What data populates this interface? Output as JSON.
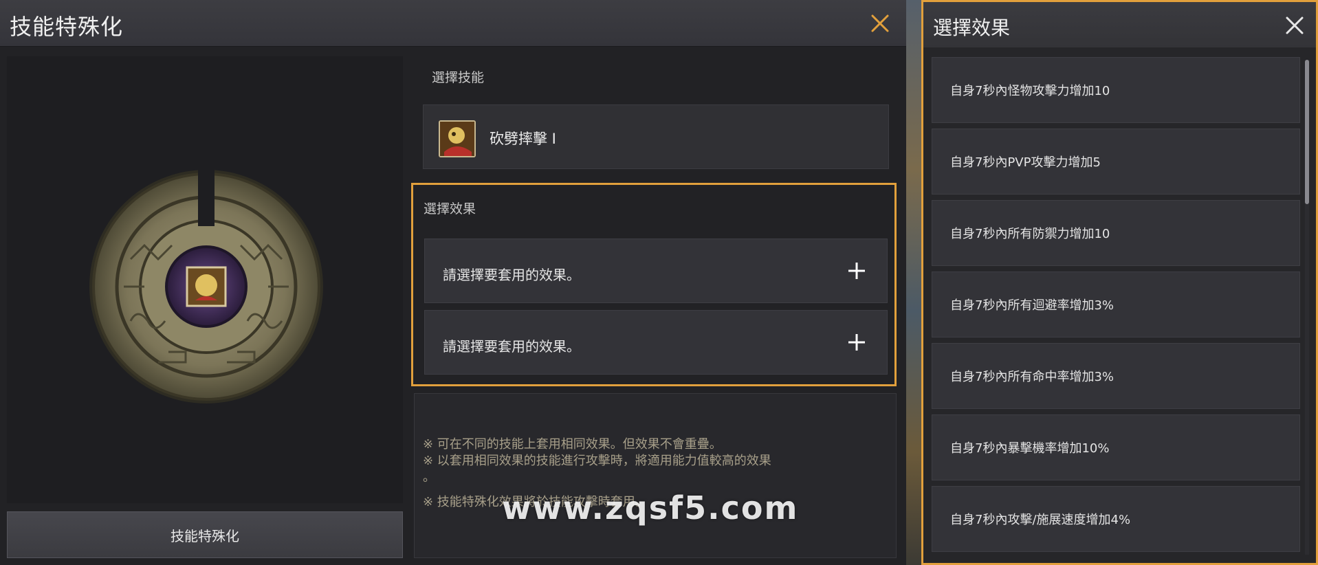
{
  "main": {
    "title": "技能特殊化",
    "specialize_button": "技能特殊化"
  },
  "skill_section": {
    "label": "選擇技能",
    "skill_name": "砍劈摔擊 I"
  },
  "effect_section": {
    "label": "選擇效果",
    "slots": [
      {
        "text": "請選擇要套用的效果。"
      },
      {
        "text": "請選擇要套用的效果。"
      }
    ]
  },
  "notes": [
    "※ 可在不同的技能上套用相同效果。但效果不會重疊。",
    "※ 以套用相同效果的技能進行攻擊時，將適用能力值較高的效果",
    "。",
    "※ 技能特殊化效果將於技能攻擊時套用。"
  ],
  "watermark": "www.zqsf5.com",
  "select_panel": {
    "title": "選擇效果",
    "options": [
      "自身7秒內怪物攻擊力增加10",
      "自身7秒內PVP攻擊力增加5",
      "自身7秒內所有防禦力增加10",
      "自身7秒內所有迴避率增加3%",
      "自身7秒內所有命中率增加3%",
      "自身7秒內暴擊機率增加10%",
      "自身7秒內攻擊/施展速度增加4%"
    ]
  },
  "colors": {
    "accent": "#e2a03c",
    "panel_bg": "#222225",
    "slot_bg": "#333338"
  },
  "icons": {
    "close": "close-icon",
    "plus": "plus-icon",
    "skill": "skill-icon",
    "emblem": "skill-emblem"
  }
}
